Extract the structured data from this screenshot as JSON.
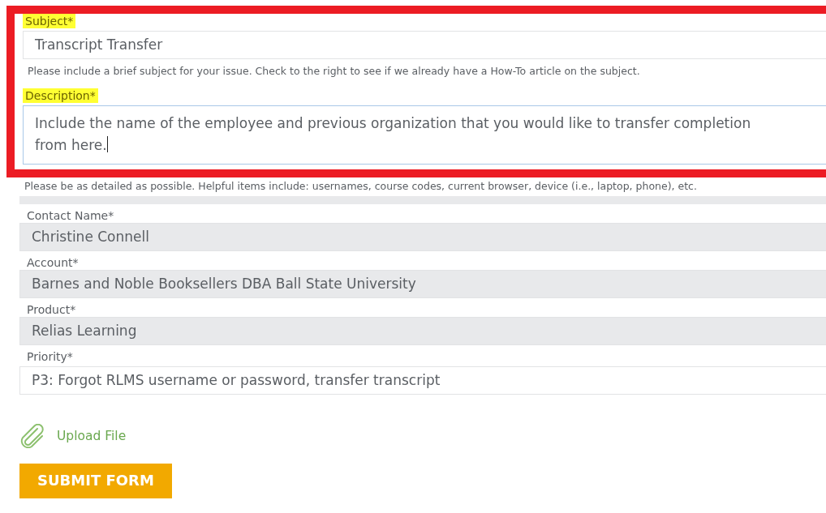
{
  "annotated_section": {
    "fields": [
      {
        "label": "Subject*",
        "highlighted": true,
        "kind": "input",
        "focused": false,
        "value": "Transcript Transfer",
        "help": "Please include a brief subject for your issue. Check to the right to see if we already have a How-To article on the subject."
      },
      {
        "label": "Description*",
        "highlighted": true,
        "kind": "textarea",
        "focused": true,
        "value": "Include the name of the employee and previous organization that you would like to transfer completion\nfrom here."
      }
    ]
  },
  "description_help": "Please be as detailed as possible. Helpful items include: usernames, course codes, current browser, device (i.e., laptop, phone), etc.",
  "fields": [
    {
      "label": "Contact Name*",
      "kind": "readonly",
      "value": "Christine Connell"
    },
    {
      "label": "Account*",
      "kind": "readonly",
      "value": "Barnes and Noble Booksellers DBA Ball State University"
    },
    {
      "label": "Product*",
      "kind": "readonly",
      "value": "Relias Learning"
    },
    {
      "label": "Priority*",
      "kind": "select",
      "value": "P3: Forgot RLMS username or password, transfer transcript"
    }
  ],
  "upload": {
    "label": "Upload File"
  },
  "submit": {
    "label": "SUBMIT FORM"
  }
}
